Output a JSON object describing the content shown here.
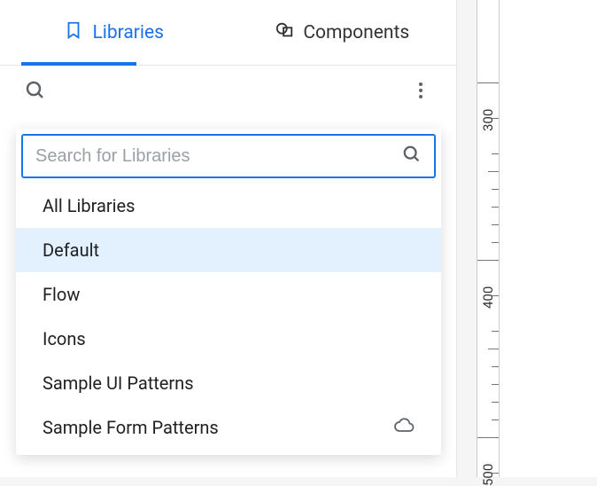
{
  "tabs": {
    "libraries": "Libraries",
    "components": "Components"
  },
  "search": {
    "placeholder": "Search for Libraries"
  },
  "library_list": [
    {
      "label": "All Libraries",
      "selected": false,
      "cloud": false
    },
    {
      "label": "Default",
      "selected": true,
      "cloud": false
    },
    {
      "label": "Flow",
      "selected": false,
      "cloud": false
    },
    {
      "label": "Icons",
      "selected": false,
      "cloud": false
    },
    {
      "label": "Sample UI Patterns",
      "selected": false,
      "cloud": false
    },
    {
      "label": "Sample Form Patterns",
      "selected": false,
      "cloud": true
    }
  ],
  "ruler": {
    "marks": [
      "300",
      "400",
      "500"
    ]
  }
}
